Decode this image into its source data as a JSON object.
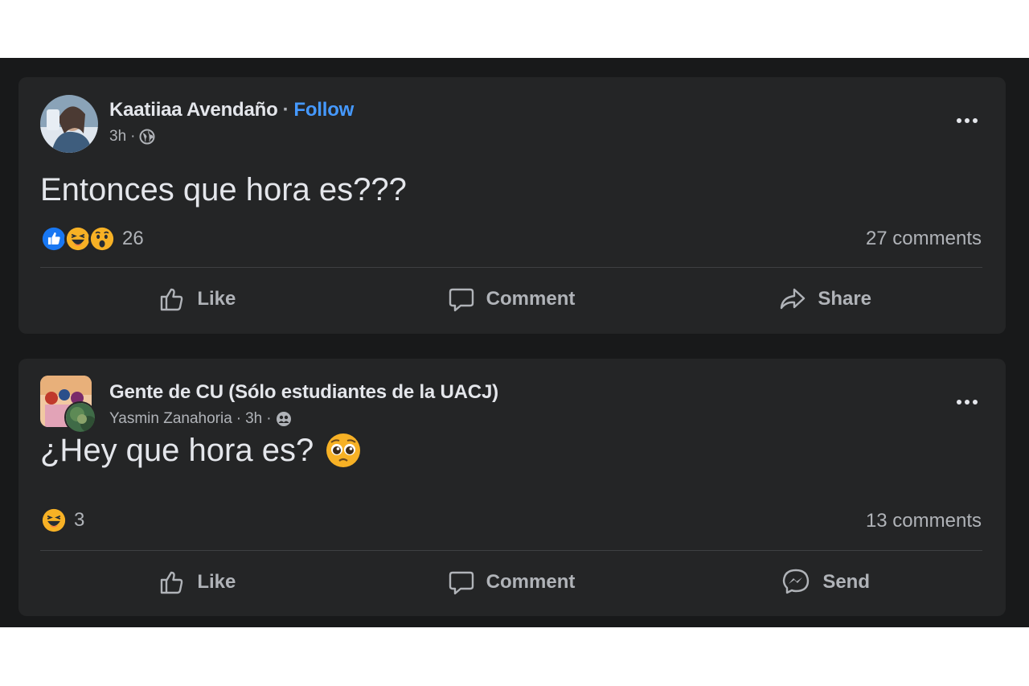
{
  "posts": [
    {
      "author": "Kaatiiaa Avendaño",
      "follow_label": "Follow",
      "dot": "·",
      "time": "3h",
      "text": "Entonces que hora es???",
      "reaction_count": "26",
      "reaction_icons": [
        "like-reaction-icon",
        "haha-reaction-icon",
        "wow-reaction-icon"
      ],
      "comments": "27 comments",
      "actions": {
        "like": "Like",
        "comment": "Comment",
        "share": "Share"
      }
    },
    {
      "group": "Gente de CU (Sólo estudiantes de la UACJ)",
      "author": "Yasmin Zanahoria",
      "dot": "·",
      "time": "3h",
      "text": "¿Hey que hora es?",
      "text_emoji": "pleading-face-emoji",
      "reaction_count": "3",
      "reaction_icons": [
        "haha-reaction-icon"
      ],
      "comments": "13 comments",
      "actions": {
        "like": "Like",
        "comment": "Comment",
        "send": "Send"
      }
    }
  ],
  "colors": {
    "feed_bg": "#18191a",
    "card_bg": "#242526",
    "primary_text": "#e4e6eb",
    "secondary_text": "#b0b3b8",
    "follow_blue": "#4599ff",
    "like_blue": "#1877f2",
    "emoji_yellow": "#f7b125"
  }
}
